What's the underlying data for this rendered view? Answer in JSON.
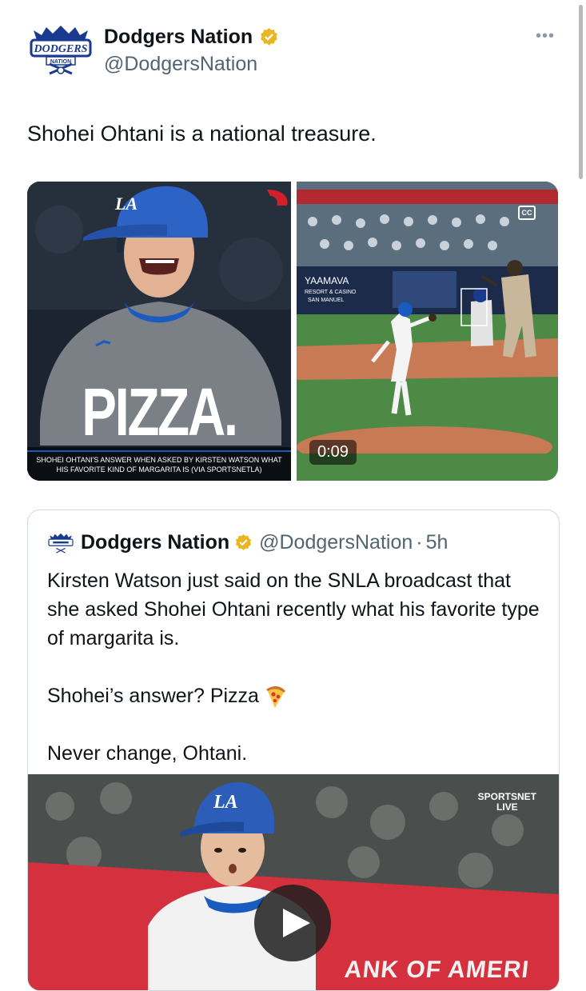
{
  "tweet": {
    "author_name": "Dodgers Nation",
    "author_handle": "@DodgersNation",
    "verified": true,
    "more_label": "•••",
    "text": "Shohei Ohtani is a national treasure.",
    "avatar_text": "DODGERS",
    "avatar_subtext": "NATION"
  },
  "media": {
    "image_headline": "PIZZA.",
    "image_caption_line1": "SHOHEI OHTANI'S ANSWER WHEN ASKED BY KIRSTEN WATSON WHAT",
    "image_caption_line2": "HIS FAVORITE KIND OF MARGARITA IS (VIA SPORTSNETLA)",
    "video_duration": "0:09",
    "video_scoreboard_text": "YAAMAVA",
    "video_scoreboard_subtext": "RESORT & CASINO",
    "video_scoreboard_subtext2": "SAN MANUEL",
    "cc_label": "CC"
  },
  "quoted_tweet": {
    "author_name": "Dodgers Nation",
    "author_handle": "@DodgersNation",
    "separator": "·",
    "time": "5h",
    "paragraph1": "Kirsten Watson just said on the SNLA broadcast that she asked Shohei Ohtani recently what his favorite type of margarita is.",
    "paragraph2": "Shohei’s answer? Pizza",
    "paragraph3": "Never change, Ohtani.",
    "video_badge_line1": "SPORTSNET",
    "video_badge_line2": "LIVE",
    "video_banner_text": "ANK OF AMERI"
  },
  "colors": {
    "text": "#0f1419",
    "secondary": "#536471",
    "border": "#cfd9de",
    "verified_gold": "#e8b620",
    "dodger_blue": "#1a5bbf"
  },
  "icons": [
    "dodgers-nation-logo-icon",
    "verified-badge-icon",
    "more-options-icon",
    "closed-captions-icon",
    "pizza-emoji-icon",
    "play-icon"
  ]
}
